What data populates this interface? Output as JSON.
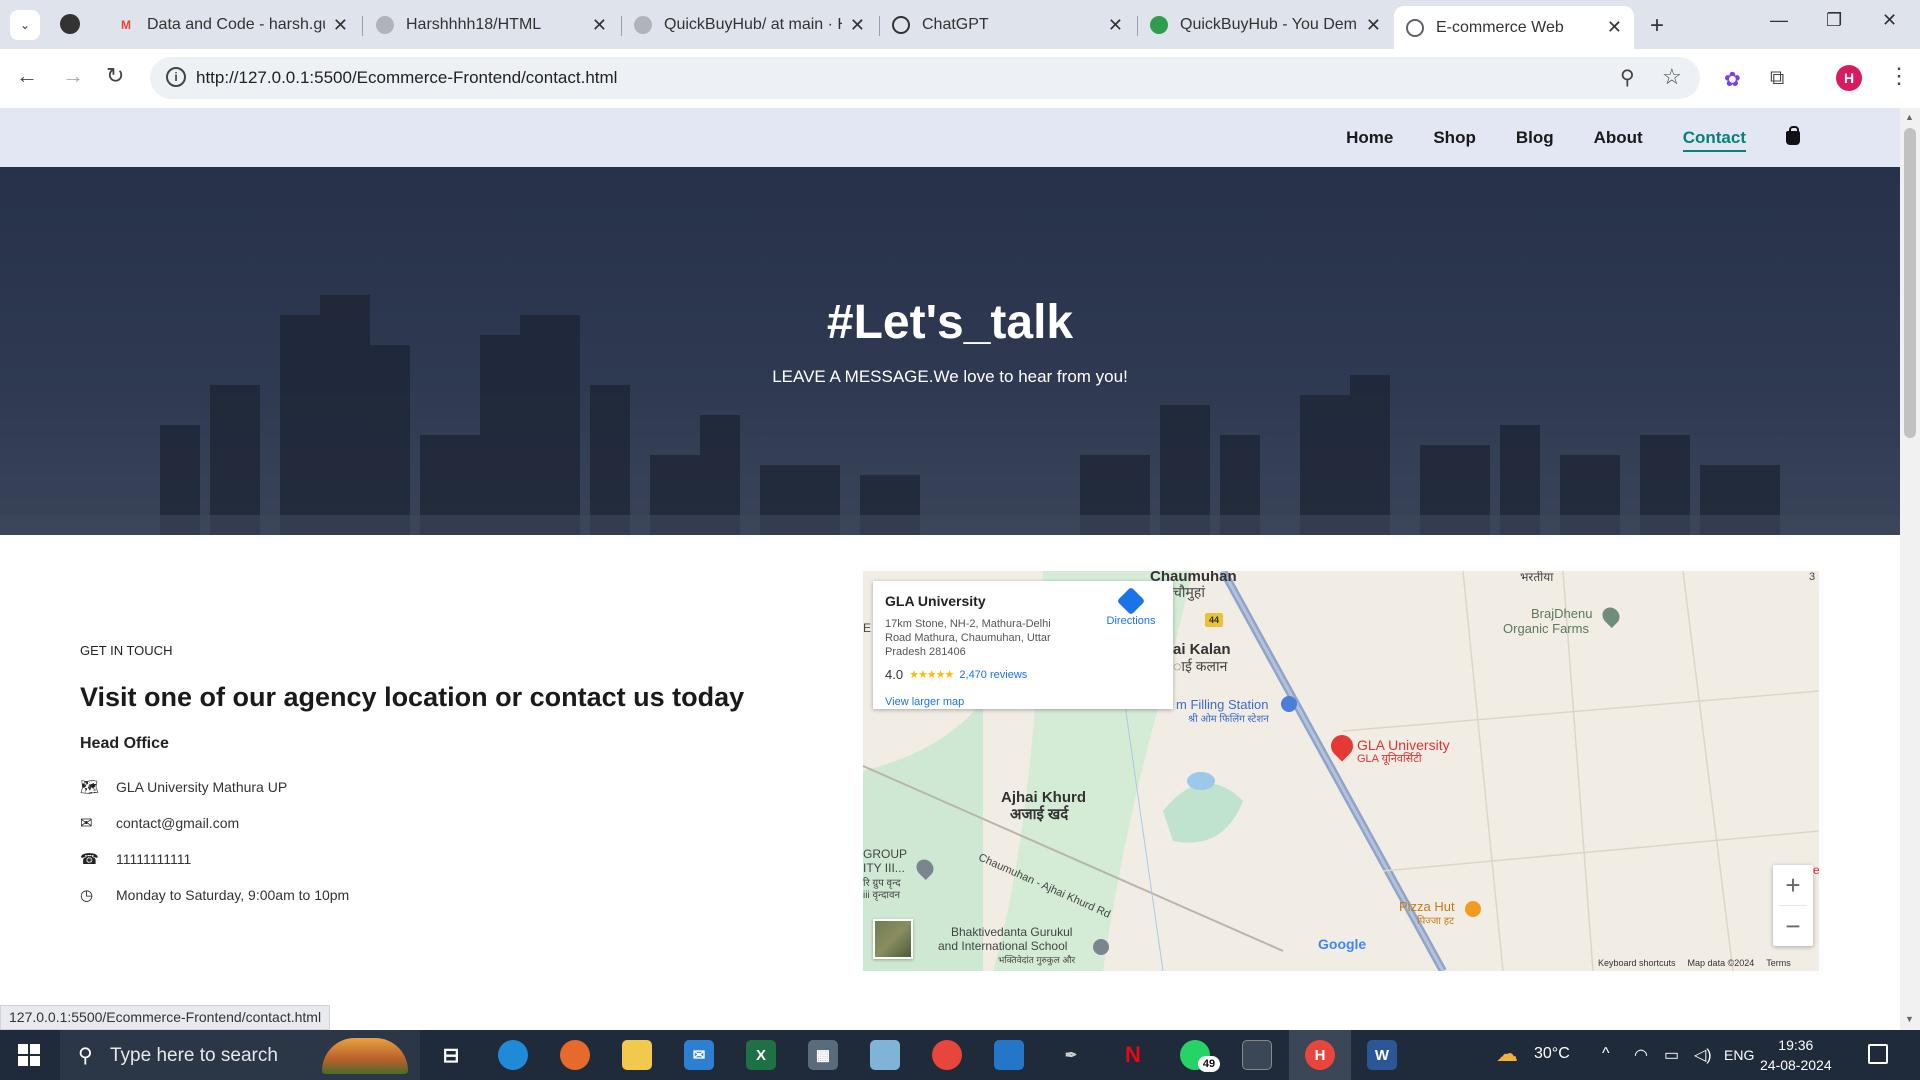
{
  "browser": {
    "tabs": [
      {
        "title": "Data and Code - harsh.gu",
        "favicon": "gmail-icon",
        "color": "#ea4335"
      },
      {
        "title": "Harshhhh18/HTML",
        "favicon": "github-icon",
        "color": "#333333"
      },
      {
        "title": "QuickBuyHub/ at main · H",
        "favicon": "github-icon",
        "color": "#333333"
      },
      {
        "title": "ChatGPT",
        "favicon": "chatgpt-icon",
        "color": "#333333"
      },
      {
        "title": "QuickBuyHub - You Dem",
        "favicon": "quickbuyhub-icon",
        "color": "#2e9e4d"
      },
      {
        "title": "E-commerce Web",
        "favicon": "globe-icon",
        "color": "#5f6368",
        "active": true
      }
    ],
    "url": "http://127.0.0.1:5500/Ecommerce-Frontend/contact.html",
    "profile_initial": "H",
    "status_url": "127.0.0.1:5500/Ecommerce-Frontend/contact.html"
  },
  "nav": {
    "links": [
      "Home",
      "Shop",
      "Blog",
      "About",
      "Contact"
    ],
    "active": "Contact",
    "accent": "#088178"
  },
  "hero": {
    "title": "#Let's_talk",
    "subtitle": "LEAVE A MESSAGE.We love to hear from you!"
  },
  "contact": {
    "kicker": "GET IN TOUCH",
    "heading": "Visit one of our agency location or contact us today",
    "subheading": "Head Office",
    "items": [
      {
        "icon": "map-icon",
        "glyph": "🗺",
        "text": "GLA University Mathura UP"
      },
      {
        "icon": "envelope-icon",
        "glyph": "✉",
        "text": "contact@gmail.com"
      },
      {
        "icon": "phone-icon",
        "glyph": "☎",
        "text": "11111111111"
      },
      {
        "icon": "clock-icon",
        "glyph": "◷",
        "text": "Monday to Saturday, 9:00am to 10pm"
      }
    ]
  },
  "map": {
    "card": {
      "place": "GLA University",
      "address": "17km Stone, NH-2, Mathura-Delhi Road Mathura, Chaumuhan, Uttar Pradesh 281406",
      "rating": "4.0",
      "stars": "★★★★★",
      "reviews": "2,470 reviews",
      "larger": "View larger map",
      "directions": "Directions"
    },
    "labels": {
      "chaumuhan": "Chaumuhan",
      "chaumuhan_hi": "चौमुहां",
      "bharatiya": "भरतीया",
      "brajdhenu": "BrajDhenu",
      "organic": "Organic Farms",
      "highway": "44",
      "kalan": "ai Kalan",
      "kalan_hi": "ाई कलान",
      "filling": "m Filling Station",
      "filling_hi": "श्री ओम फिलिंग स्टेशन",
      "gla": "GLA University",
      "gla_hi": "GLA यूनिवर्सिटी",
      "ajhai": "Ajhai Khurd",
      "ajhai_hi": "अजाई खर्द",
      "road": "Chaumuhan - Ajhai Khurd Rd",
      "group": "GROUP",
      "ity": "ITY III...",
      "group_hi": "रि ग्रुप वृन्द",
      "group_hi2": "iii वृन्दावन",
      "pizza": "Pizza Hut",
      "pizza_hi": "पिज्जा हट",
      "bhakti": "Bhaktivedanta Gurukul",
      "bhakti2": "and International School",
      "bhakti_hi": "भक्तिवेदांत गुरुकुल और",
      "google": "Google",
      "edge_e": "E",
      "edge_3": "3",
      "edge_e2": "e"
    },
    "footer": [
      "Keyboard shortcuts",
      "Map data ©2024",
      "Terms"
    ],
    "zoom_in": "+",
    "zoom_out": "−"
  },
  "taskbar": {
    "search_placeholder": "Type here to search",
    "whatsapp_badge": "49",
    "temperature": "30°C",
    "language": "ENG",
    "time": "19:36",
    "date": "24-08-2024"
  }
}
